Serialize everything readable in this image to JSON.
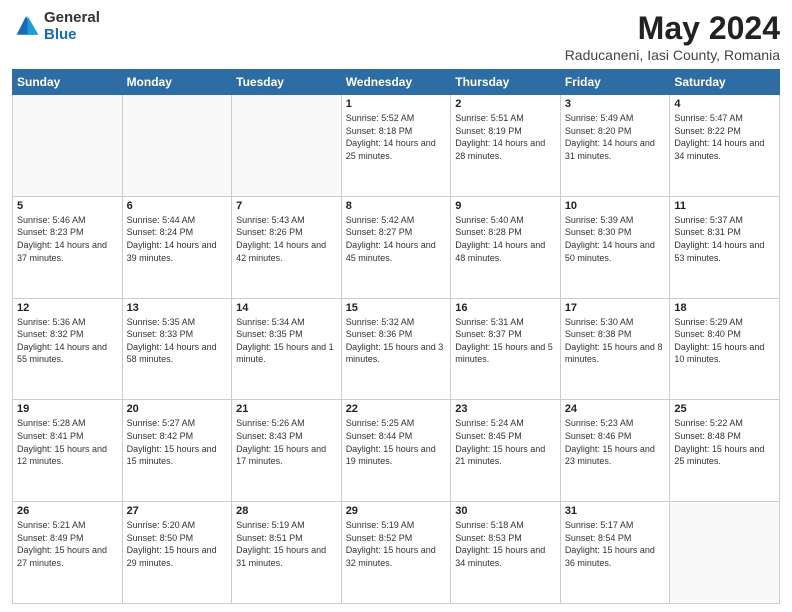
{
  "header": {
    "logo_general": "General",
    "logo_blue": "Blue",
    "month_year": "May 2024",
    "location": "Raducaneni, Iasi County, Romania"
  },
  "weekdays": [
    "Sunday",
    "Monday",
    "Tuesday",
    "Wednesday",
    "Thursday",
    "Friday",
    "Saturday"
  ],
  "weeks": [
    [
      {
        "day": "",
        "info": ""
      },
      {
        "day": "",
        "info": ""
      },
      {
        "day": "",
        "info": ""
      },
      {
        "day": "1",
        "info": "Sunrise: 5:52 AM\nSunset: 8:18 PM\nDaylight: 14 hours\nand 25 minutes."
      },
      {
        "day": "2",
        "info": "Sunrise: 5:51 AM\nSunset: 8:19 PM\nDaylight: 14 hours\nand 28 minutes."
      },
      {
        "day": "3",
        "info": "Sunrise: 5:49 AM\nSunset: 8:20 PM\nDaylight: 14 hours\nand 31 minutes."
      },
      {
        "day": "4",
        "info": "Sunrise: 5:47 AM\nSunset: 8:22 PM\nDaylight: 14 hours\nand 34 minutes."
      }
    ],
    [
      {
        "day": "5",
        "info": "Sunrise: 5:46 AM\nSunset: 8:23 PM\nDaylight: 14 hours\nand 37 minutes."
      },
      {
        "day": "6",
        "info": "Sunrise: 5:44 AM\nSunset: 8:24 PM\nDaylight: 14 hours\nand 39 minutes."
      },
      {
        "day": "7",
        "info": "Sunrise: 5:43 AM\nSunset: 8:26 PM\nDaylight: 14 hours\nand 42 minutes."
      },
      {
        "day": "8",
        "info": "Sunrise: 5:42 AM\nSunset: 8:27 PM\nDaylight: 14 hours\nand 45 minutes."
      },
      {
        "day": "9",
        "info": "Sunrise: 5:40 AM\nSunset: 8:28 PM\nDaylight: 14 hours\nand 48 minutes."
      },
      {
        "day": "10",
        "info": "Sunrise: 5:39 AM\nSunset: 8:30 PM\nDaylight: 14 hours\nand 50 minutes."
      },
      {
        "day": "11",
        "info": "Sunrise: 5:37 AM\nSunset: 8:31 PM\nDaylight: 14 hours\nand 53 minutes."
      }
    ],
    [
      {
        "day": "12",
        "info": "Sunrise: 5:36 AM\nSunset: 8:32 PM\nDaylight: 14 hours\nand 55 minutes."
      },
      {
        "day": "13",
        "info": "Sunrise: 5:35 AM\nSunset: 8:33 PM\nDaylight: 14 hours\nand 58 minutes."
      },
      {
        "day": "14",
        "info": "Sunrise: 5:34 AM\nSunset: 8:35 PM\nDaylight: 15 hours\nand 1 minute."
      },
      {
        "day": "15",
        "info": "Sunrise: 5:32 AM\nSunset: 8:36 PM\nDaylight: 15 hours\nand 3 minutes."
      },
      {
        "day": "16",
        "info": "Sunrise: 5:31 AM\nSunset: 8:37 PM\nDaylight: 15 hours\nand 5 minutes."
      },
      {
        "day": "17",
        "info": "Sunrise: 5:30 AM\nSunset: 8:38 PM\nDaylight: 15 hours\nand 8 minutes."
      },
      {
        "day": "18",
        "info": "Sunrise: 5:29 AM\nSunset: 8:40 PM\nDaylight: 15 hours\nand 10 minutes."
      }
    ],
    [
      {
        "day": "19",
        "info": "Sunrise: 5:28 AM\nSunset: 8:41 PM\nDaylight: 15 hours\nand 12 minutes."
      },
      {
        "day": "20",
        "info": "Sunrise: 5:27 AM\nSunset: 8:42 PM\nDaylight: 15 hours\nand 15 minutes."
      },
      {
        "day": "21",
        "info": "Sunrise: 5:26 AM\nSunset: 8:43 PM\nDaylight: 15 hours\nand 17 minutes."
      },
      {
        "day": "22",
        "info": "Sunrise: 5:25 AM\nSunset: 8:44 PM\nDaylight: 15 hours\nand 19 minutes."
      },
      {
        "day": "23",
        "info": "Sunrise: 5:24 AM\nSunset: 8:45 PM\nDaylight: 15 hours\nand 21 minutes."
      },
      {
        "day": "24",
        "info": "Sunrise: 5:23 AM\nSunset: 8:46 PM\nDaylight: 15 hours\nand 23 minutes."
      },
      {
        "day": "25",
        "info": "Sunrise: 5:22 AM\nSunset: 8:48 PM\nDaylight: 15 hours\nand 25 minutes."
      }
    ],
    [
      {
        "day": "26",
        "info": "Sunrise: 5:21 AM\nSunset: 8:49 PM\nDaylight: 15 hours\nand 27 minutes."
      },
      {
        "day": "27",
        "info": "Sunrise: 5:20 AM\nSunset: 8:50 PM\nDaylight: 15 hours\nand 29 minutes."
      },
      {
        "day": "28",
        "info": "Sunrise: 5:19 AM\nSunset: 8:51 PM\nDaylight: 15 hours\nand 31 minutes."
      },
      {
        "day": "29",
        "info": "Sunrise: 5:19 AM\nSunset: 8:52 PM\nDaylight: 15 hours\nand 32 minutes."
      },
      {
        "day": "30",
        "info": "Sunrise: 5:18 AM\nSunset: 8:53 PM\nDaylight: 15 hours\nand 34 minutes."
      },
      {
        "day": "31",
        "info": "Sunrise: 5:17 AM\nSunset: 8:54 PM\nDaylight: 15 hours\nand 36 minutes."
      },
      {
        "day": "",
        "info": ""
      }
    ]
  ]
}
